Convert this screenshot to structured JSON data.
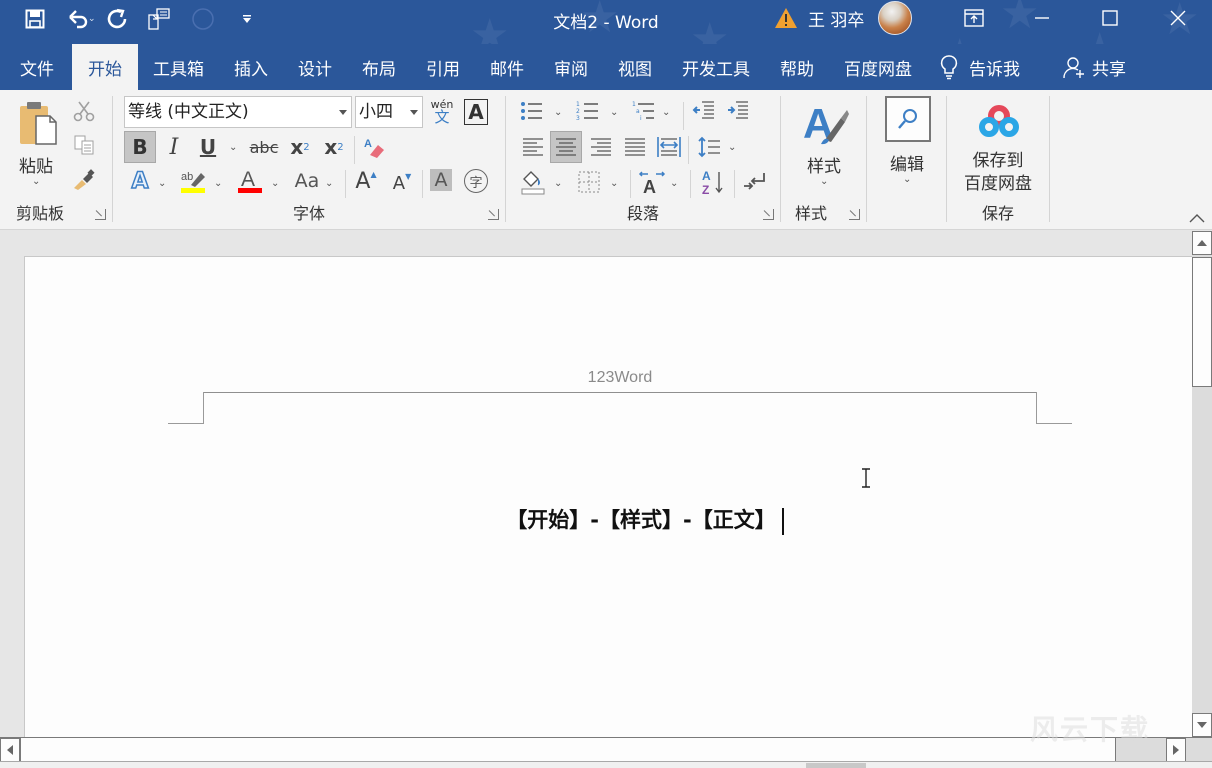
{
  "titlebar": {
    "title": "文档2 - Word",
    "user_name": "王 羽卒",
    "qat": [
      "save-icon",
      "undo-icon",
      "redo-icon",
      "touch-mode-icon",
      "circle-icon",
      "customize-qat-icon"
    ],
    "controls": [
      "ribbon-display-options-icon",
      "minimize-icon",
      "maximize-icon",
      "close-icon"
    ]
  },
  "tabs": {
    "items": [
      {
        "label": "文件",
        "active": false
      },
      {
        "label": "开始",
        "active": true
      },
      {
        "label": "工具箱",
        "active": false
      },
      {
        "label": "插入",
        "active": false
      },
      {
        "label": "设计",
        "active": false
      },
      {
        "label": "布局",
        "active": false
      },
      {
        "label": "引用",
        "active": false
      },
      {
        "label": "邮件",
        "active": false
      },
      {
        "label": "审阅",
        "active": false
      },
      {
        "label": "视图",
        "active": false
      },
      {
        "label": "开发工具",
        "active": false
      },
      {
        "label": "帮助",
        "active": false
      },
      {
        "label": "百度网盘",
        "active": false
      }
    ],
    "tell_me": "告诉我",
    "share": "共享"
  },
  "ribbon": {
    "clipboard": {
      "label": "剪贴板",
      "paste": "粘贴"
    },
    "font": {
      "label": "字体",
      "font_name": "等线 (中文正文)",
      "font_size": "小四",
      "bold": "B",
      "italic": "I",
      "underline": "U",
      "strikethrough": "abc",
      "subscript": "x",
      "subscript_mark": "2",
      "superscript": "x",
      "superscript_mark": "2",
      "phonetic_top": "wén",
      "phonetic_bottom": "文",
      "char_border": "A",
      "text_effect": "A",
      "highlight_letters": "ab",
      "font_color": "A",
      "change_case": "Aa",
      "grow_font": "A",
      "shrink_font": "A",
      "char_shading": "A",
      "enclose_char": "字",
      "highlight_color": "#ffff00",
      "font_color_value": "#ff0000",
      "bold_active": true
    },
    "paragraph": {
      "label": "段落",
      "center_active": true
    },
    "styles": {
      "label": "样式",
      "button": "样式"
    },
    "editing": {
      "button": "编辑"
    },
    "save": {
      "label": "保存",
      "button_line1": "保存到",
      "button_line2": "百度网盘"
    }
  },
  "document": {
    "header_text": "123Word",
    "body_text": "【开始】-【样式】-【正文】"
  },
  "watermark": "风云下载"
}
